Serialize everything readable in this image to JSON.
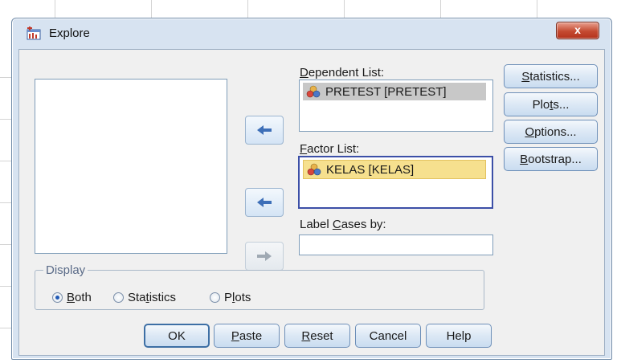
{
  "window": {
    "title": "Explore",
    "close_glyph": "x"
  },
  "move_buttons": {
    "glyph": "➜"
  },
  "dependent": {
    "label_pre": "",
    "label_u": "D",
    "label_post": "ependent List:",
    "items": [
      {
        "label": "PRETEST [PRETEST]"
      }
    ]
  },
  "factor": {
    "label_pre": "",
    "label_u": "F",
    "label_post": "actor List:",
    "items": [
      {
        "label": "KELAS [KELAS]"
      }
    ]
  },
  "label_cases": {
    "label_pre": "Label ",
    "label_u": "C",
    "label_post": "ases by:",
    "value": ""
  },
  "side_buttons": {
    "statistics": {
      "pre": "",
      "u": "S",
      "post": "tatistics..."
    },
    "plots": {
      "pre": "Plo",
      "u": "t",
      "post": "s..."
    },
    "options": {
      "pre": "",
      "u": "O",
      "post": "ptions..."
    },
    "bootstrap": {
      "pre": "",
      "u": "B",
      "post": "ootstrap..."
    }
  },
  "display": {
    "title": "Display",
    "both": {
      "pre": "",
      "u": "B",
      "post": "oth",
      "selected": true
    },
    "statistics": {
      "pre": "Sta",
      "u": "t",
      "post": "istics",
      "selected": false
    },
    "plots": {
      "pre": "P",
      "u": "l",
      "post": "ots",
      "selected": false
    }
  },
  "bottom_buttons": {
    "ok": "OK",
    "paste": {
      "pre": "",
      "u": "P",
      "post": "aste"
    },
    "reset": {
      "pre": "",
      "u": "R",
      "post": "eset"
    },
    "cancel": "Cancel",
    "help": "Help"
  },
  "colors": {
    "accent": "#3c4fa7",
    "selection_yellow": "#f6e08e",
    "selection_gray": "#c8c8c8"
  }
}
